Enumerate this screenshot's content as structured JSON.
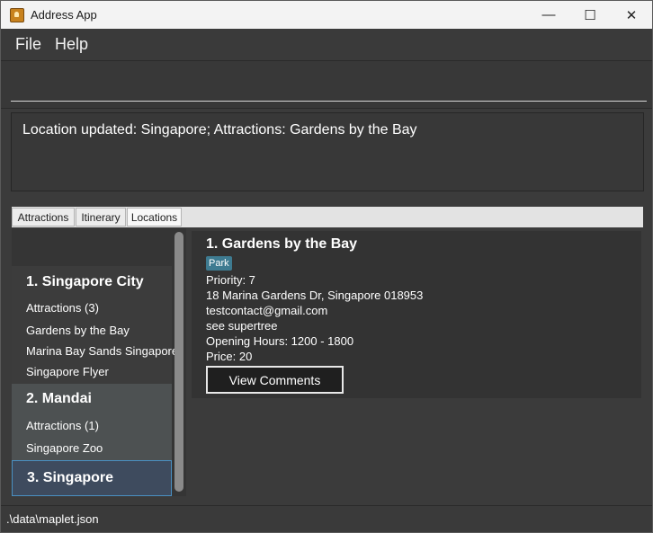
{
  "window": {
    "title": "Address App",
    "controls": {
      "minimize": "—",
      "maximize": "☐",
      "close": "✕"
    }
  },
  "menu": {
    "items": [
      "File",
      "Help"
    ]
  },
  "command_box": {
    "value": "",
    "placeholder": ""
  },
  "result_display": {
    "text": "Location updated: Singapore; Attractions: Gardens by the Bay"
  },
  "tabs": [
    {
      "label": "Attractions",
      "active": false
    },
    {
      "label": "Itinerary",
      "active": false
    },
    {
      "label": "Locations",
      "active": true
    }
  ],
  "locations": [
    {
      "title": "1.  Singapore City",
      "attractions_label": "Attractions (3)",
      "attractions": [
        "Gardens by the Bay",
        "Marina Bay Sands Singapore",
        "Singapore Flyer"
      ]
    },
    {
      "title": "2.  Mandai",
      "attractions_label": "Attractions (1)",
      "attractions": [
        "Singapore Zoo"
      ]
    },
    {
      "title": "3.  Singapore",
      "attractions_label": "",
      "attractions": []
    }
  ],
  "detail": {
    "title": "1.  Gardens by the Bay",
    "tag": "Park",
    "lines": [
      "Priority: 7",
      "18 Marina Gardens Dr, Singapore 018953",
      "testcontact@gmail.com",
      "see supertree",
      "Opening Hours: 1200 - 1800",
      "Price: 20"
    ],
    "button_label": "View Comments"
  },
  "status_bar": {
    "path": ".\\data\\maplet.json"
  },
  "colors": {
    "background": "#3a3a3a",
    "titlebar": "#f3f3f3",
    "tag": "#3e7b91",
    "card_1": "#3c3c3c",
    "card_2": "#4d5152",
    "card_3_selected": "#3e4b5e",
    "card_3_border": "#4a90c2"
  }
}
